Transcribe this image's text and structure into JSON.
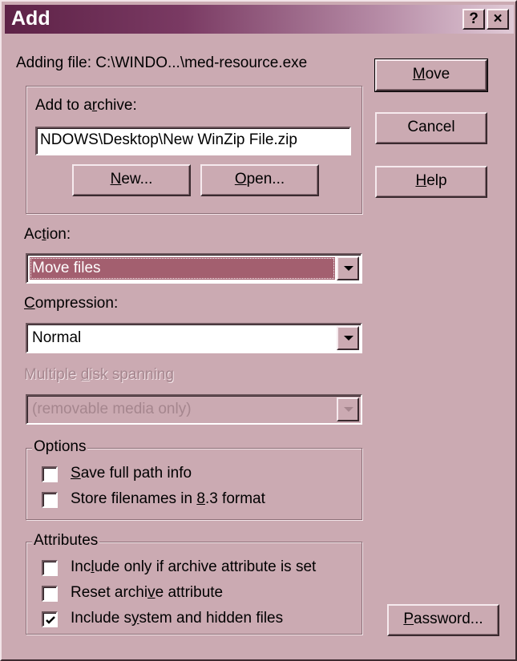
{
  "window": {
    "title": "Add",
    "help_glyph": "?",
    "close_glyph": "×"
  },
  "adding_file": "Adding file: C:\\WINDO...\\med-resource.exe",
  "archive": {
    "label_pre": "Add to a",
    "label_key": "r",
    "label_post": "chive:",
    "value": "NDOWS\\Desktop\\New WinZip File.zip",
    "new_key": "N",
    "new_rest": "ew...",
    "open_key": "O",
    "open_rest": "pen..."
  },
  "buttons": {
    "move_key": "M",
    "move_rest": "ove",
    "cancel": "Cancel",
    "help_key": "H",
    "help_rest": "elp",
    "password_key": "P",
    "password_rest": "assword..."
  },
  "action": {
    "label_pre": "Ac",
    "label_key": "t",
    "label_post": "ion:",
    "value": "Move files"
  },
  "compression": {
    "label_key": "C",
    "label_post": "ompression:",
    "value": "Normal"
  },
  "spanning": {
    "label_pre": "Multiple ",
    "label_key": "d",
    "label_post": "isk spanning",
    "value": "(removable media only)"
  },
  "options": {
    "legend": "Options",
    "items": [
      {
        "pre": "",
        "key": "S",
        "post": "ave full path info",
        "checked": false
      },
      {
        "pre": "Store filenames in ",
        "key": "8",
        "post": ".3 format",
        "checked": false
      }
    ]
  },
  "attributes": {
    "legend": "Attributes",
    "items": [
      {
        "pre": "Inc",
        "key": "l",
        "post": "ude only if archive attribute is set",
        "checked": false
      },
      {
        "pre": "Reset archi",
        "key": "v",
        "post": "e attribute",
        "checked": false
      },
      {
        "pre": "Include s",
        "key": "y",
        "post": "stem and hidden files",
        "checked": true
      }
    ]
  },
  "colors": {
    "face": "#cbaab2",
    "selection": "#a35f6f",
    "title_start": "#5e2247"
  }
}
